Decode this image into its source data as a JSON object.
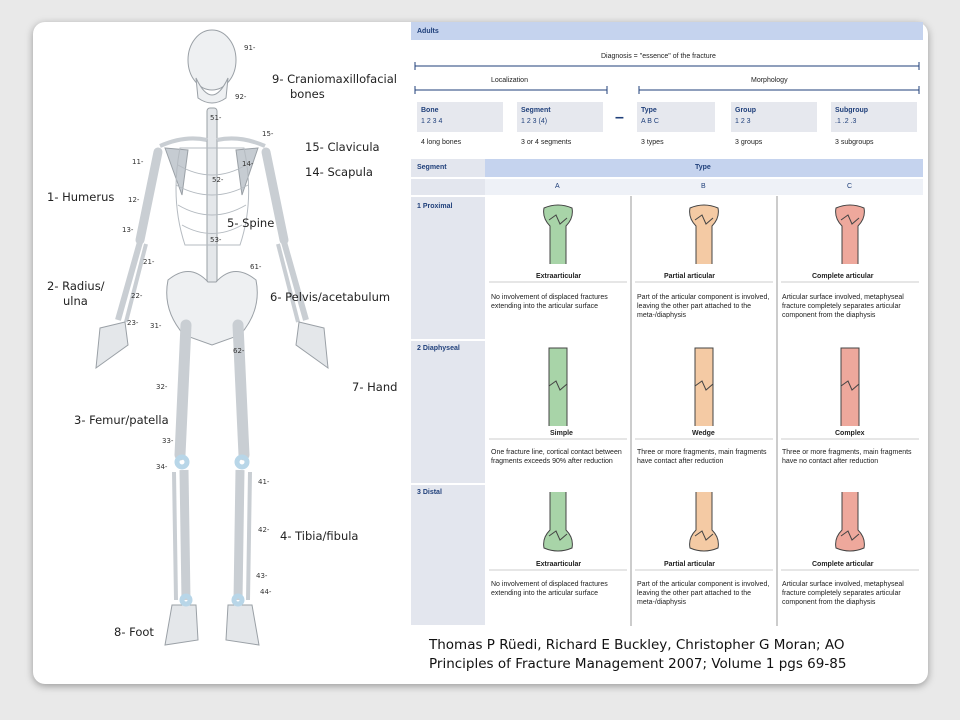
{
  "skeleton": {
    "labels": {
      "cranio": "9- Craniomaxillofacial",
      "cranio2": "bones",
      "clavicula": "15- Clavicula",
      "scapula": "14- Scapula",
      "humerus": "1- Humerus",
      "spine": "5- Spine",
      "radius": "2- Radius/",
      "radius2": "ulna",
      "pelvis": "6- Pelvis/acetabulum",
      "hand": "7- Hand",
      "femur": "3- Femur/patella",
      "tibia": "4- Tibia/fibula",
      "foot": "8- Foot"
    },
    "numbers": [
      "91-",
      "92-",
      "51-",
      "52-",
      "53-",
      "15-",
      "14-",
      "11-",
      "12-",
      "13-",
      "21-",
      "22-",
      "23-",
      "61-",
      "31-",
      "62-",
      "32-",
      "33-",
      "34-",
      "41-",
      "42-",
      "43-",
      "44-"
    ]
  },
  "table": {
    "header": "Adults",
    "diagnosis": "Diagnosis = \"essence\" of the fracture",
    "localization": "Localization",
    "morphology": "Morphology",
    "dash": "–",
    "boxes": [
      {
        "title": "Bone",
        "code": "1 2 3 4",
        "desc": "4 long bones"
      },
      {
        "title": "Segment",
        "code": "1 2 3 (4)",
        "desc": "3 or 4 segments"
      },
      {
        "title": "Type",
        "code": "A B C",
        "desc": "3 types"
      },
      {
        "title": "Group",
        "code": "1 2 3",
        "desc": "3 groups"
      },
      {
        "title": "Subgroup",
        "code": ".1 .2 .3",
        "desc": "3 subgroups"
      }
    ],
    "segment_header": "Segment",
    "type_header": "Type",
    "cols": [
      "A",
      "B",
      "C"
    ],
    "rows": [
      {
        "name": "1 Proximal",
        "cells": [
          {
            "title": "Extraarticular",
            "desc": "No involvement of displaced fractures extending into the articular surface"
          },
          {
            "title": "Partial articular",
            "desc": "Part of the articular component is involved, leaving the other part attached to the meta-/diaphysis"
          },
          {
            "title": "Complete articular",
            "desc": "Articular surface involved, metaphyseal fracture completely separates articular component from the diaphysis"
          }
        ]
      },
      {
        "name": "2 Diaphyseal",
        "cells": [
          {
            "title": "Simple",
            "desc": "One fracture line, cortical contact between fragments exceeds 90% after reduction"
          },
          {
            "title": "Wedge",
            "desc": "Three or more fragments, main fragments have contact after reduction"
          },
          {
            "title": "Complex",
            "desc": "Three or more fragments, main fragments have no contact after reduction"
          }
        ]
      },
      {
        "name": "3 Distal",
        "cells": [
          {
            "title": "Extraarticular",
            "desc": "No involvement of displaced fractures extending into the articular surface"
          },
          {
            "title": "Partial articular",
            "desc": "Part of the articular component is involved, leaving the other part attached to the meta-/diaphysis"
          },
          {
            "title": "Complete articular",
            "desc": "Articular surface involved, metaphyseal fracture completely separates articular component from the diaphysis"
          }
        ]
      }
    ],
    "colors": {
      "header_bg": "#c5d3ee",
      "row_label_bg": "#e3e6ee",
      "type_a": "#a8d4a8",
      "type_b": "#f4caa4",
      "type_c": "#eea89c",
      "bone_outline": "#444"
    }
  },
  "citation": {
    "line1": "Thomas P Rüedi, Richard E Buckley, Christopher G Moran; AO",
    "line2": "Principles of Fracture Management 2007; Volume 1 pgs 69-85"
  }
}
